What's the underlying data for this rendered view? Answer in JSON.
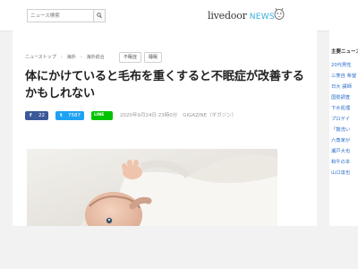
{
  "search": {
    "placeholder": "ニュース検索"
  },
  "logo": {
    "brand": "livedoor",
    "suffix": "NEWS"
  },
  "breadcrumb": {
    "items": [
      "ニューストップ",
      "海外",
      "海外総合"
    ],
    "tags": [
      "不眠症",
      "睡眠"
    ]
  },
  "article": {
    "title": "体にかけていると毛布を重くすると不眠症が改善するかもしれない",
    "date": "2020年9月24日 23時0分",
    "source": "GIGAZINE（ギガジン）"
  },
  "share": {
    "facebook": {
      "icon": "f",
      "count": "22"
    },
    "twitter": {
      "icon": "t",
      "count": "7587"
    },
    "line": {
      "label": "LINE"
    }
  },
  "sidebar": {
    "heading": "主要ニュース",
    "items": [
      "20代男性",
      "三菱自 希望",
      "日大 講師",
      "国勢調査",
      "下水処理",
      "プロゲイ",
      "「鼓洗い",
      "六角家が",
      "瀬戸大也",
      "和牛の本",
      "山口達也"
    ]
  },
  "colors": {
    "facebook": "#3b5998",
    "twitter": "#1da1f2",
    "line": "#00c300",
    "link": "#2a6ec9",
    "news_accent": "#37b0e0"
  }
}
